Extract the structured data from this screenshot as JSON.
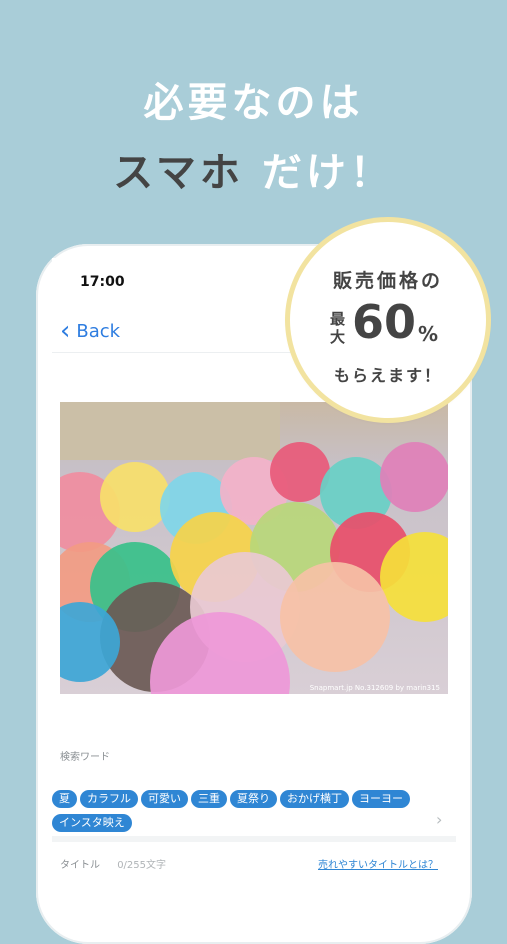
{
  "headline": {
    "line1": "必要なのは",
    "line2_dark": "スマホ",
    "line2_light": "だけ！"
  },
  "status": {
    "time": "17:00"
  },
  "nav": {
    "back_label": "Back"
  },
  "badge": {
    "line1": "販売価格の",
    "small1": "最",
    "small2": "大",
    "number": "60",
    "percent": "%",
    "line3": "もらえます！"
  },
  "photo": {
    "credit": "Snapmart.jp No.312609 by marin315"
  },
  "search": {
    "label": "検索ワード",
    "tags": [
      "夏",
      "カラフル",
      "可愛い",
      "三重",
      "夏祭り",
      "おかげ横丁",
      "ヨーヨー",
      "インスタ映え"
    ]
  },
  "title_field": {
    "label": "タイトル",
    "count": "0/255文字",
    "link": "売れやすいタイトルとは？"
  }
}
